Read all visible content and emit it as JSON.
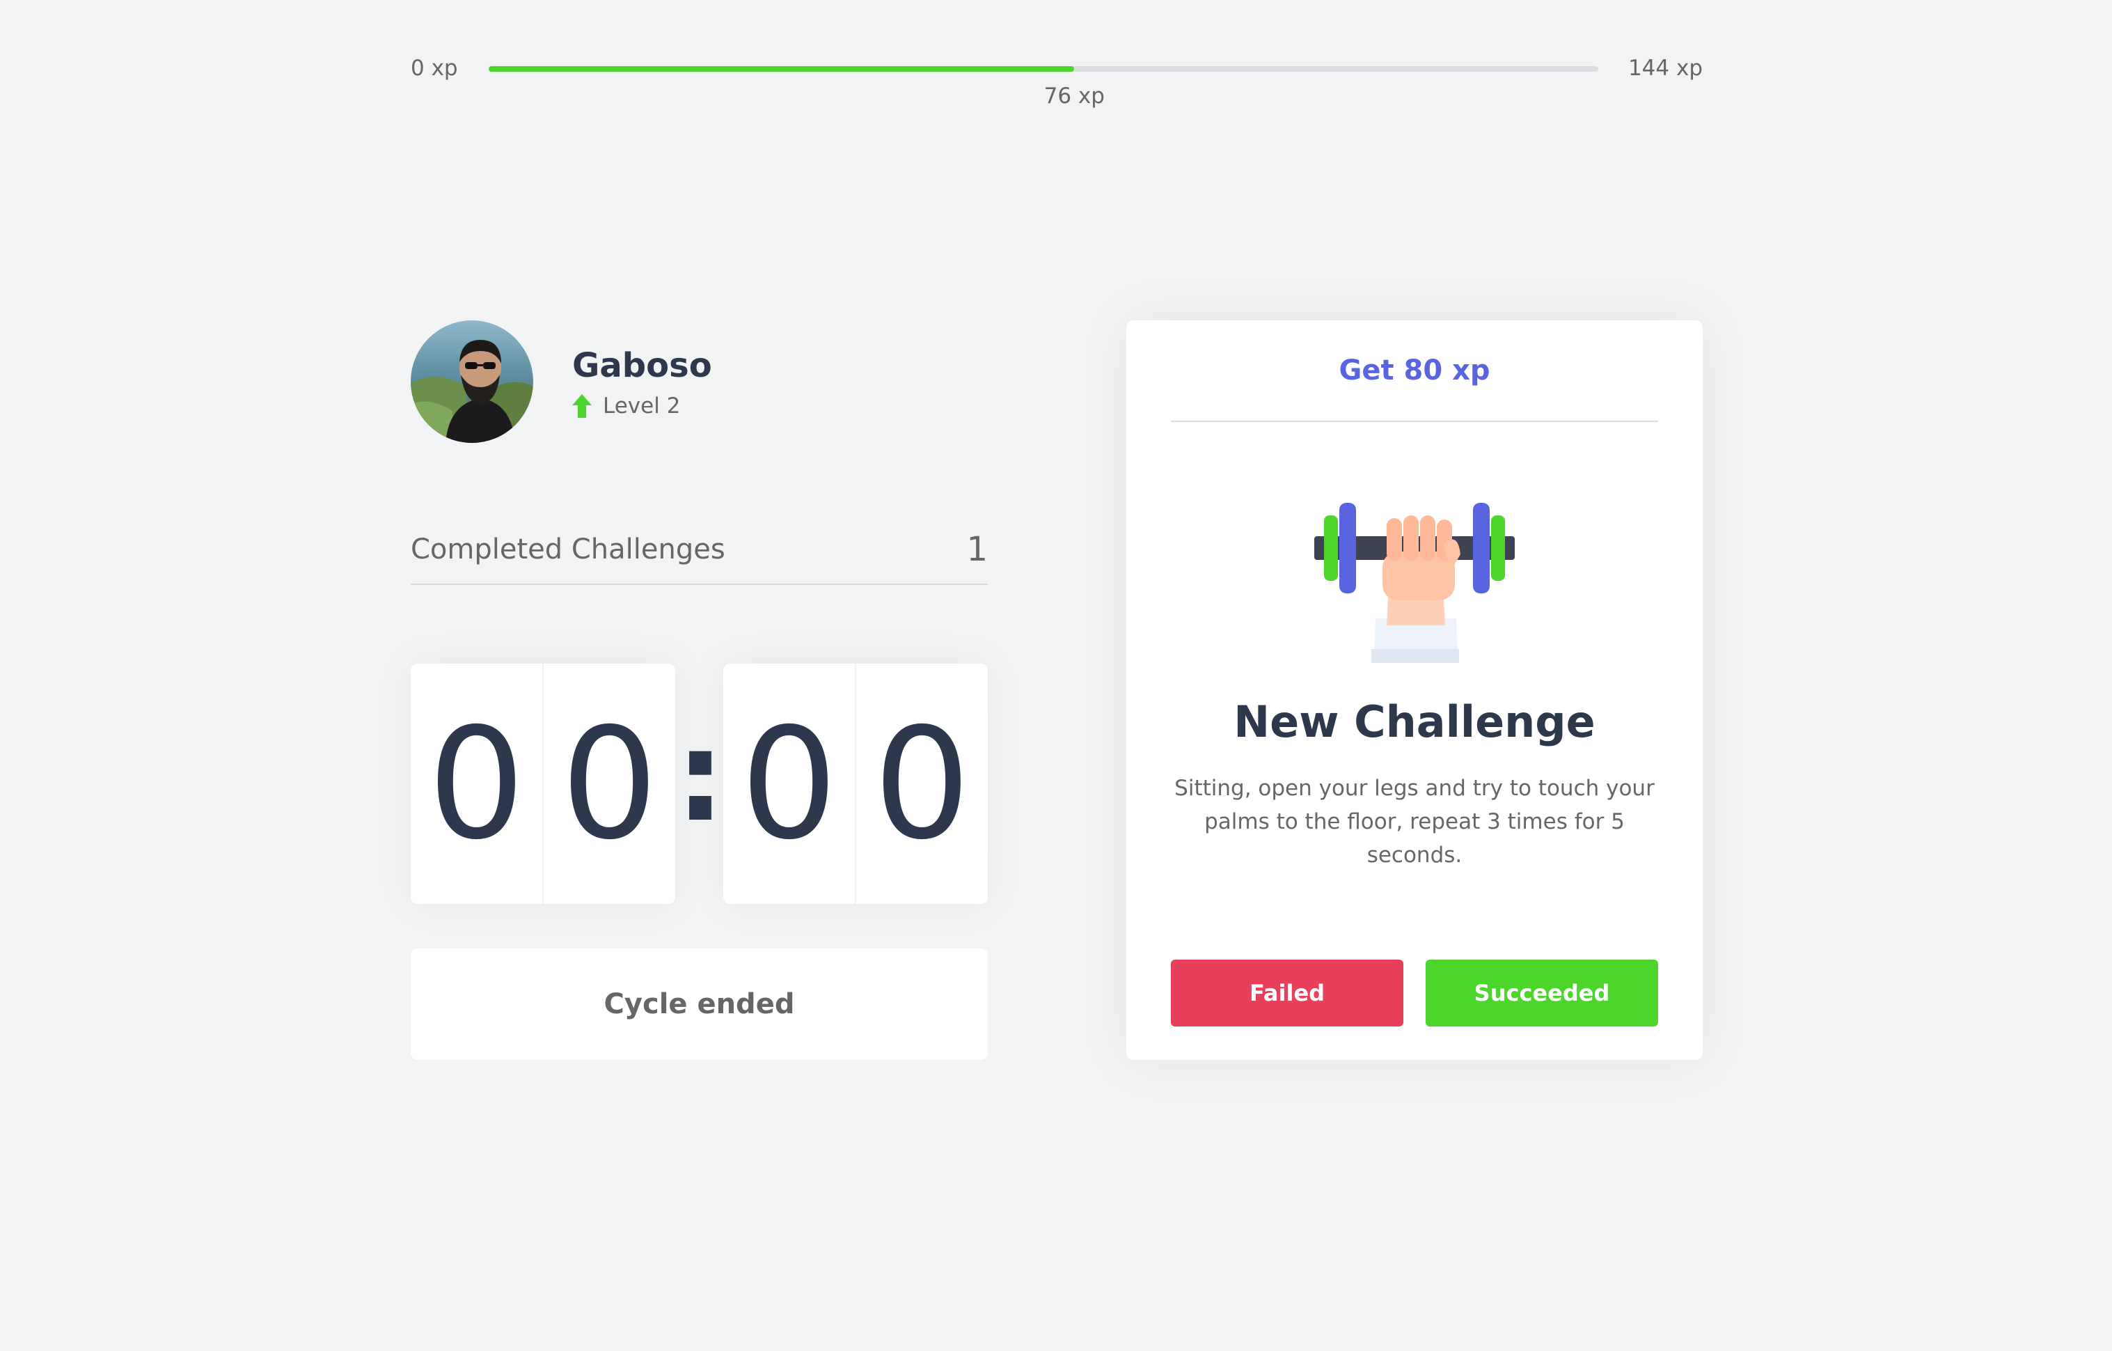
{
  "experience": {
    "min_label": "0 xp",
    "max_label": "144 xp",
    "current_label": "76 xp",
    "current_xp": 76,
    "max_xp": 144
  },
  "profile": {
    "name": "Gaboso",
    "level_label": "Level 2",
    "avatar": "avatar-photo",
    "level_icon": "level-up-arrow-icon"
  },
  "completed": {
    "label": "Completed Challenges",
    "count": "1"
  },
  "countdown": {
    "minute_left": "0",
    "minute_right": "0",
    "separator": ":",
    "second_left": "0",
    "second_right": "0"
  },
  "cycle_button": {
    "label": "Cycle ended"
  },
  "challenge": {
    "reward": "Get 80 xp",
    "icon": "dumbbell-icon",
    "title": "New Challenge",
    "description": "Sitting, open your legs and try to touch your palms to the floor, repeat 3 times for 5 seconds.",
    "failed_label": "Failed",
    "succeeded_label": "Succeeded"
  },
  "colors": {
    "background": "#f2f3f5",
    "green": "#4cd62b",
    "red": "#e83f5b",
    "blue": "#5965e0",
    "title": "#2e384d",
    "text": "#666666"
  }
}
